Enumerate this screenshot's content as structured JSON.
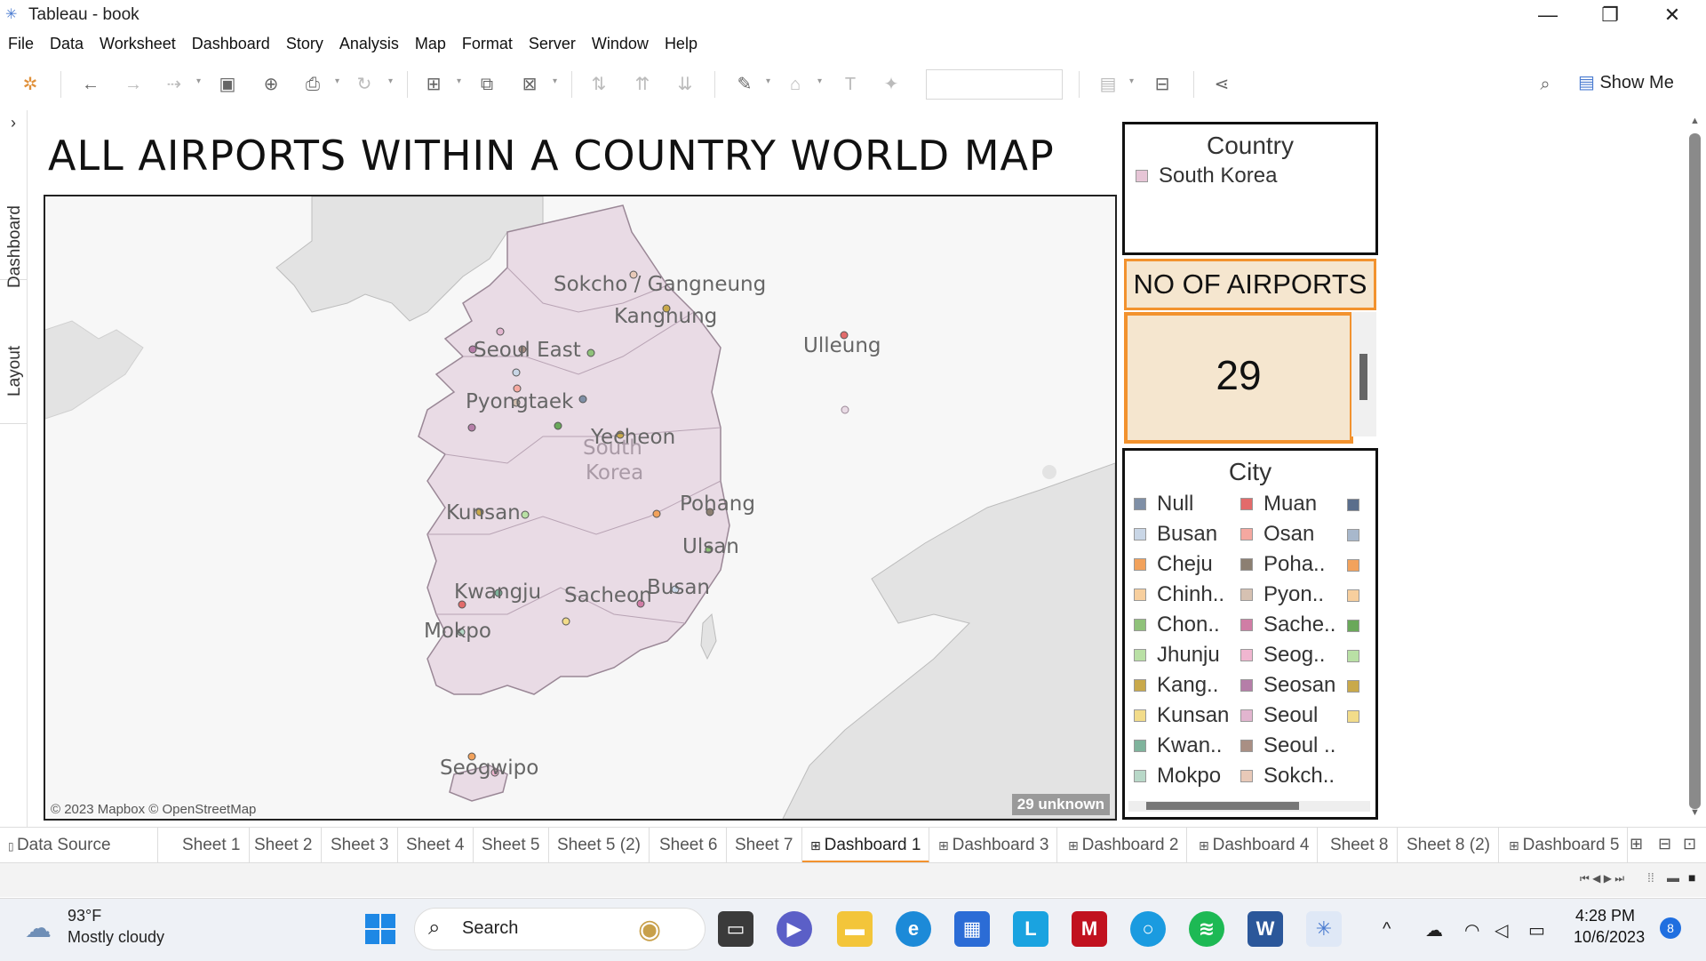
{
  "window": {
    "title": "Tableau - book",
    "minimize": "—",
    "maximize": "❐",
    "close": "✕"
  },
  "menu": [
    "File",
    "Data",
    "Worksheet",
    "Dashboard",
    "Story",
    "Analysis",
    "Map",
    "Format",
    "Server",
    "Window",
    "Help"
  ],
  "toolbar": {
    "show_me": "Show Me"
  },
  "side_tabs": {
    "dashboard": "Dashboard",
    "layout": "Layout",
    "expand": "›"
  },
  "dashboard": {
    "title": "ALL AIRPORTS WITHIN A COUNTRY WORLD MAP"
  },
  "map": {
    "credit": "© 2023 Mapbox © OpenStreetMap",
    "unknown": "29 unknown",
    "country_label_1": "South",
    "country_label_2": "Korea",
    "city_labels": [
      "Sokcho / Gangneung",
      "Kangnung",
      "Ulleung",
      "Seoul East",
      "Pyongtaek",
      "Yecheon",
      "Kunsan",
      "Pohang",
      "Ulsan",
      "Kwangju",
      "Sacheon",
      "Busan",
      "Mokpo",
      "Seogwipo"
    ]
  },
  "country_filter": {
    "title": "Country",
    "item": "South Korea",
    "swatch_color": "#e6c5d6"
  },
  "airports": {
    "header": "NO OF AIRPORTS",
    "value": "29",
    "accent": "#f2922e",
    "fill": "#f5e6cf"
  },
  "city_legend": {
    "title": "City",
    "col1": [
      {
        "label": "Null",
        "color": "#7f8fa6"
      },
      {
        "label": "Busan",
        "color": "#c9d6e6"
      },
      {
        "label": "Cheju",
        "color": "#f2a25c"
      },
      {
        "label": "Chinh..",
        "color": "#f7cf9e"
      },
      {
        "label": "Chon..",
        "color": "#8fc27a"
      },
      {
        "label": "Jhunju",
        "color": "#b9e0a5"
      },
      {
        "label": "Kang..",
        "color": "#c9a94b"
      },
      {
        "label": "Kunsan",
        "color": "#f2dc8a"
      },
      {
        "label": "Kwan..",
        "color": "#7fb39c"
      },
      {
        "label": "Mokpo",
        "color": "#b8d8c8"
      }
    ],
    "col2": [
      {
        "label": "Muan",
        "color": "#e26b6b"
      },
      {
        "label": "Osan",
        "color": "#f5a8a0"
      },
      {
        "label": "Poha..",
        "color": "#8c7f72"
      },
      {
        "label": "Pyon..",
        "color": "#d6c1b2"
      },
      {
        "label": "Sache..",
        "color": "#d07da5"
      },
      {
        "label": "Seog..",
        "color": "#f0b6d0"
      },
      {
        "label": "Seosan",
        "color": "#b57ea8"
      },
      {
        "label": "Seoul",
        "color": "#e2b5cf"
      },
      {
        "label": "Seoul ..",
        "color": "#a98f84"
      },
      {
        "label": "Sokch..",
        "color": "#e8c9b8"
      }
    ],
    "col3": [
      "#5a6e8c",
      "#a8b8cc",
      "#f2a25c",
      "#f7cf9e",
      "#6aa85a",
      "#b9e0a5",
      "#c9a94b",
      "#f2dc8a"
    ]
  },
  "sheet_tabs": [
    "Data Source",
    "Sheet 1",
    "Sheet 2",
    "Sheet 3",
    "Sheet 4",
    "Sheet 5",
    "Sheet 5 (2)",
    "Sheet 6",
    "Sheet 7",
    "Dashboard 1",
    "Dashboard 3",
    "Dashboard 2",
    "Dashboard 4",
    "Sheet 8",
    "Sheet 8 (2)",
    "Dashboard 5"
  ],
  "active_tab": "Dashboard 1",
  "taskbar": {
    "weather_temp": "93°F",
    "weather_desc": "Mostly cloudy",
    "search": "Search",
    "time": "4:28 PM",
    "date": "10/6/2023",
    "notifications": "8"
  }
}
